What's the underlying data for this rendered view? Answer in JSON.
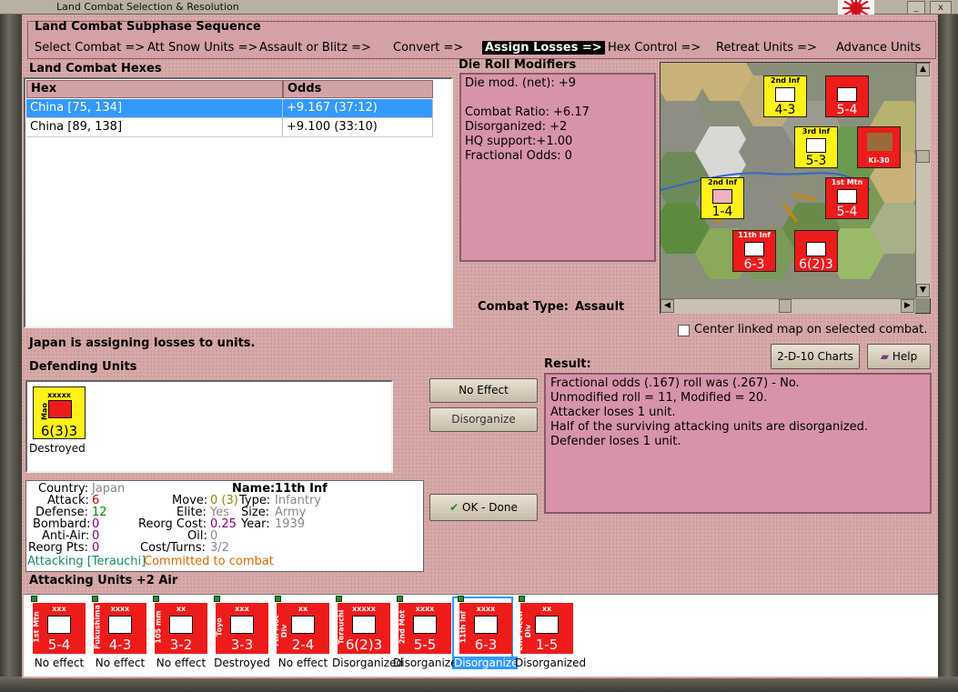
{
  "window": {
    "title": "Land Combat Selection & Resolution",
    "minimize": "_",
    "close": "x"
  },
  "sequence": {
    "heading": "Land Combat Subphase Sequence",
    "steps": [
      "Select Combat =>",
      "Att Snow Units =>",
      "Assault or Blitz =>",
      "Convert =>",
      "Assign Losses =>",
      "Hex Control =>",
      "Retreat Units =>",
      "Advance Units"
    ],
    "active_index": 4
  },
  "hexes": {
    "heading": "Land Combat Hexes",
    "columns": [
      "Hex",
      "Odds"
    ],
    "rows": [
      {
        "hex": "China [75, 134]",
        "odds": "+9.167 (37:12)",
        "selected": true
      },
      {
        "hex": "China [89, 138]",
        "odds": "+9.100 (33:10)",
        "selected": false
      }
    ]
  },
  "modifiers": {
    "heading": "Die Roll Modifiers",
    "lines": [
      "Die mod. (net): +9",
      "",
      "Combat Ratio: +6.17",
      "Disorganized: +2",
      "HQ support:+1.00",
      "Fractional Odds: 0"
    ]
  },
  "combat_type": {
    "label": "Combat Type:",
    "value": "Assault"
  },
  "map": {
    "center_label": "Center linked map on selected combat.",
    "counters": [
      {
        "name": "2nd Inf",
        "num": "4-3",
        "color": "yellow"
      },
      {
        "name": "",
        "num": "5-4",
        "color": "red"
      },
      {
        "name": "3rd Inf",
        "num": "5-3",
        "color": "yellow"
      },
      {
        "name": "Ki-30",
        "num": "",
        "color": "red"
      },
      {
        "name": "2nd Inf",
        "num": "1-4",
        "color": "yellow"
      },
      {
        "name": "1st Mtn",
        "num": "5-4",
        "color": "red"
      },
      {
        "name": "11th Inf",
        "num": "6-3",
        "color": "red"
      },
      {
        "name": "",
        "num": "6(2)3",
        "color": "red"
      }
    ],
    "stack_numbers": [
      "2",
      "2",
      "4",
      "3",
      "3",
      "3",
      "8"
    ]
  },
  "status_text": "Japan is assigning losses to units.",
  "buttons": {
    "charts": "2-D-10 Charts",
    "help": "Help",
    "no_effect": "No Effect",
    "disorganize": "Disorganize",
    "ok": "OK - Done"
  },
  "defending": {
    "heading": "Defending Units",
    "units": [
      {
        "name": "Mao",
        "type": "xxxxx",
        "num": "6(3)3",
        "status": "Destroyed"
      }
    ]
  },
  "info": {
    "country_label": "Country:",
    "country": "Japan",
    "attack_label": "Attack:",
    "attack": "6",
    "defense_label": "Defense:",
    "defense": "12",
    "bombard_label": "Bombard:",
    "bombard": "0",
    "antiair_label": "Anti-Air:",
    "antiair": "0",
    "reorgpts_label": "Reorg Pts:",
    "reorgpts": "0",
    "name_label": "Name:",
    "name": "11th Inf",
    "move_label": "Move:",
    "move": "0 (3)",
    "type_label": "Type:",
    "type": "Infantry",
    "elite_label": "Elite:",
    "elite": "Yes",
    "size_label": "Size:",
    "size": "Army",
    "reorgcost_label": "Reorg Cost:",
    "reorgcost": "0.25",
    "year_label": "Year:",
    "year": "1939",
    "oil_label": "Oil:",
    "oil": "0",
    "costturns_label": "Cost/Turns:",
    "costturns": "3/2",
    "attacking_note": "Attacking [Terauchi]",
    "committed_note": "Committed to combat"
  },
  "result": {
    "heading": "Result:",
    "lines": [
      "Fractional odds (.167) roll was (.267)  - No.",
      "Unmodified roll = 11, Modified = 20.",
      "Attacker loses 1 unit.",
      "Half of the surviving attacking units are disorganized.",
      "Defender loses 1 unit."
    ]
  },
  "attacking": {
    "heading": "Attacking Units +2 Air",
    "units": [
      {
        "name": "1st Mtn",
        "type": "xxx",
        "num": "5-4",
        "status": "No effect"
      },
      {
        "name": "Fukushima",
        "type": "xxxx",
        "num": "4-3",
        "status": "No effect"
      },
      {
        "name": "105 mm",
        "type": "xx",
        "num": "3-2",
        "status": "No effect"
      },
      {
        "name": "Toyo",
        "type": "xxx",
        "num": "3-3",
        "status": "Destroyed"
      },
      {
        "name": "7th Mot Div",
        "type": "xx",
        "num": "2-4",
        "status": "No effect"
      },
      {
        "name": "Terauchi",
        "type": "xxxxx",
        "num": "6(2)3",
        "status": "Disorganized"
      },
      {
        "name": "2nd Mot",
        "type": "xxxx",
        "num": "5-5",
        "status": "Disorganized"
      },
      {
        "name": "11th Inf",
        "type": "xxxx",
        "num": "6-3",
        "status": "Disorganized"
      },
      {
        "name": "2nd Mech Div",
        "type": "xx",
        "num": "1-5",
        "status": "Disorganized"
      }
    ],
    "selected_index": 7
  },
  "colors": {
    "panel": "#d7a9a9",
    "counter_red": "#ee1b1b",
    "counter_yellow": "#fff21a",
    "attack_red": "#d00000",
    "defense_green": "#008800",
    "purple": "#800080",
    "teal": "#1a8a6a",
    "orange": "#d86a00"
  }
}
